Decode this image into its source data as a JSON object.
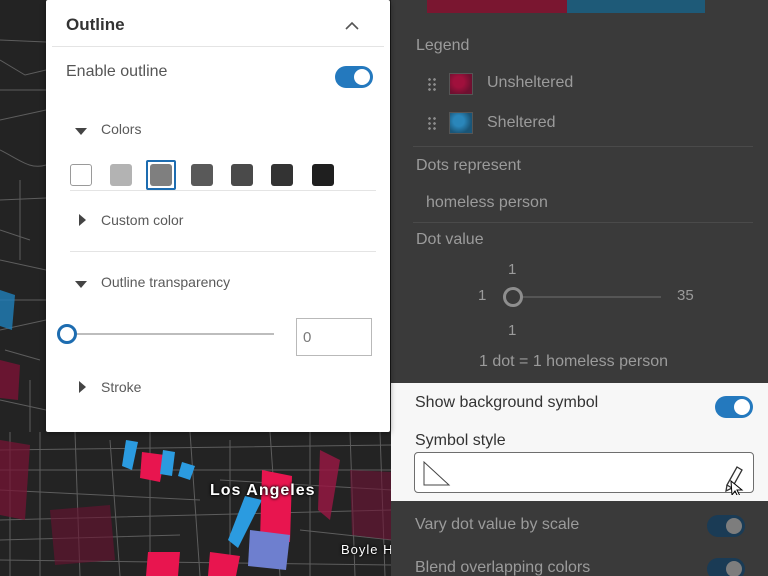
{
  "outline_panel": {
    "title": "Outline",
    "enable_outline_label": "Enable outline",
    "enable_outline_on": true,
    "colors_label": "Colors",
    "color_swatches": [
      "#ffffff",
      "#b3b3b3",
      "#7f7f7f",
      "#595959",
      "#4a4a4a",
      "#333333",
      "#1f1f1f"
    ],
    "selected_swatch_index": 2,
    "custom_color_label": "Custom color",
    "outline_transparency_label": "Outline transparency",
    "transparency_value": "0",
    "transparency_fraction": 0,
    "stroke_label": "Stroke"
  },
  "dim_panel": {
    "legend_label": "Legend",
    "legend_items": [
      {
        "label": "Unsheltered",
        "color": "#c8104a"
      },
      {
        "label": "Sheltered",
        "color": "#1f8fce"
      }
    ],
    "dots_represent_label": "Dots represent",
    "dots_represent_value": "homeless person",
    "dot_value_label": "Dot value",
    "dot_value_top": "1",
    "dot_value_min": "1",
    "dot_value_max": "35",
    "dot_value_bottom": "1",
    "dot_summary": "1 dot = 1 homeless person"
  },
  "light_panel": {
    "show_background_label": "Show background symbol",
    "show_background_on": true,
    "symbol_style_label": "Symbol style"
  },
  "dim_bottom": {
    "vary_dot_label": "Vary dot value by scale",
    "blend_label": "Blend overlapping colors"
  },
  "map": {
    "city_label": "Los Angeles",
    "neighborhood_label": "Boyle Heights",
    "colors": {
      "unsheltered": "#e8154f",
      "sheltered": "#2b9be0"
    }
  }
}
